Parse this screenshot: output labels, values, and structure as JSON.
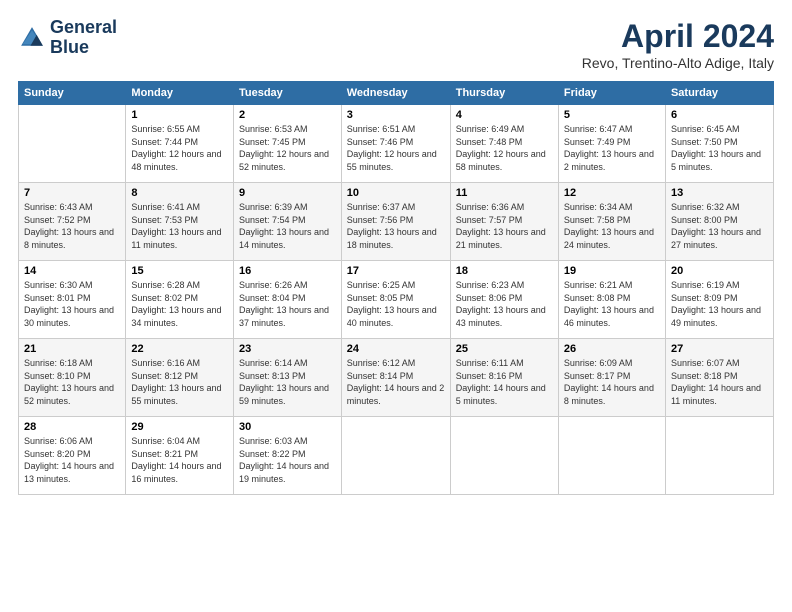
{
  "header": {
    "logo_line1": "General",
    "logo_line2": "Blue",
    "title": "April 2024",
    "subtitle": "Revo, Trentino-Alto Adige, Italy"
  },
  "weekdays": [
    "Sunday",
    "Monday",
    "Tuesday",
    "Wednesday",
    "Thursday",
    "Friday",
    "Saturday"
  ],
  "weeks": [
    [
      {
        "day": "",
        "sunrise": "",
        "sunset": "",
        "daylight": ""
      },
      {
        "day": "1",
        "sunrise": "Sunrise: 6:55 AM",
        "sunset": "Sunset: 7:44 PM",
        "daylight": "Daylight: 12 hours and 48 minutes."
      },
      {
        "day": "2",
        "sunrise": "Sunrise: 6:53 AM",
        "sunset": "Sunset: 7:45 PM",
        "daylight": "Daylight: 12 hours and 52 minutes."
      },
      {
        "day": "3",
        "sunrise": "Sunrise: 6:51 AM",
        "sunset": "Sunset: 7:46 PM",
        "daylight": "Daylight: 12 hours and 55 minutes."
      },
      {
        "day": "4",
        "sunrise": "Sunrise: 6:49 AM",
        "sunset": "Sunset: 7:48 PM",
        "daylight": "Daylight: 12 hours and 58 minutes."
      },
      {
        "day": "5",
        "sunrise": "Sunrise: 6:47 AM",
        "sunset": "Sunset: 7:49 PM",
        "daylight": "Daylight: 13 hours and 2 minutes."
      },
      {
        "day": "6",
        "sunrise": "Sunrise: 6:45 AM",
        "sunset": "Sunset: 7:50 PM",
        "daylight": "Daylight: 13 hours and 5 minutes."
      }
    ],
    [
      {
        "day": "7",
        "sunrise": "Sunrise: 6:43 AM",
        "sunset": "Sunset: 7:52 PM",
        "daylight": "Daylight: 13 hours and 8 minutes."
      },
      {
        "day": "8",
        "sunrise": "Sunrise: 6:41 AM",
        "sunset": "Sunset: 7:53 PM",
        "daylight": "Daylight: 13 hours and 11 minutes."
      },
      {
        "day": "9",
        "sunrise": "Sunrise: 6:39 AM",
        "sunset": "Sunset: 7:54 PM",
        "daylight": "Daylight: 13 hours and 14 minutes."
      },
      {
        "day": "10",
        "sunrise": "Sunrise: 6:37 AM",
        "sunset": "Sunset: 7:56 PM",
        "daylight": "Daylight: 13 hours and 18 minutes."
      },
      {
        "day": "11",
        "sunrise": "Sunrise: 6:36 AM",
        "sunset": "Sunset: 7:57 PM",
        "daylight": "Daylight: 13 hours and 21 minutes."
      },
      {
        "day": "12",
        "sunrise": "Sunrise: 6:34 AM",
        "sunset": "Sunset: 7:58 PM",
        "daylight": "Daylight: 13 hours and 24 minutes."
      },
      {
        "day": "13",
        "sunrise": "Sunrise: 6:32 AM",
        "sunset": "Sunset: 8:00 PM",
        "daylight": "Daylight: 13 hours and 27 minutes."
      }
    ],
    [
      {
        "day": "14",
        "sunrise": "Sunrise: 6:30 AM",
        "sunset": "Sunset: 8:01 PM",
        "daylight": "Daylight: 13 hours and 30 minutes."
      },
      {
        "day": "15",
        "sunrise": "Sunrise: 6:28 AM",
        "sunset": "Sunset: 8:02 PM",
        "daylight": "Daylight: 13 hours and 34 minutes."
      },
      {
        "day": "16",
        "sunrise": "Sunrise: 6:26 AM",
        "sunset": "Sunset: 8:04 PM",
        "daylight": "Daylight: 13 hours and 37 minutes."
      },
      {
        "day": "17",
        "sunrise": "Sunrise: 6:25 AM",
        "sunset": "Sunset: 8:05 PM",
        "daylight": "Daylight: 13 hours and 40 minutes."
      },
      {
        "day": "18",
        "sunrise": "Sunrise: 6:23 AM",
        "sunset": "Sunset: 8:06 PM",
        "daylight": "Daylight: 13 hours and 43 minutes."
      },
      {
        "day": "19",
        "sunrise": "Sunrise: 6:21 AM",
        "sunset": "Sunset: 8:08 PM",
        "daylight": "Daylight: 13 hours and 46 minutes."
      },
      {
        "day": "20",
        "sunrise": "Sunrise: 6:19 AM",
        "sunset": "Sunset: 8:09 PM",
        "daylight": "Daylight: 13 hours and 49 minutes."
      }
    ],
    [
      {
        "day": "21",
        "sunrise": "Sunrise: 6:18 AM",
        "sunset": "Sunset: 8:10 PM",
        "daylight": "Daylight: 13 hours and 52 minutes."
      },
      {
        "day": "22",
        "sunrise": "Sunrise: 6:16 AM",
        "sunset": "Sunset: 8:12 PM",
        "daylight": "Daylight: 13 hours and 55 minutes."
      },
      {
        "day": "23",
        "sunrise": "Sunrise: 6:14 AM",
        "sunset": "Sunset: 8:13 PM",
        "daylight": "Daylight: 13 hours and 59 minutes."
      },
      {
        "day": "24",
        "sunrise": "Sunrise: 6:12 AM",
        "sunset": "Sunset: 8:14 PM",
        "daylight": "Daylight: 14 hours and 2 minutes."
      },
      {
        "day": "25",
        "sunrise": "Sunrise: 6:11 AM",
        "sunset": "Sunset: 8:16 PM",
        "daylight": "Daylight: 14 hours and 5 minutes."
      },
      {
        "day": "26",
        "sunrise": "Sunrise: 6:09 AM",
        "sunset": "Sunset: 8:17 PM",
        "daylight": "Daylight: 14 hours and 8 minutes."
      },
      {
        "day": "27",
        "sunrise": "Sunrise: 6:07 AM",
        "sunset": "Sunset: 8:18 PM",
        "daylight": "Daylight: 14 hours and 11 minutes."
      }
    ],
    [
      {
        "day": "28",
        "sunrise": "Sunrise: 6:06 AM",
        "sunset": "Sunset: 8:20 PM",
        "daylight": "Daylight: 14 hours and 13 minutes."
      },
      {
        "day": "29",
        "sunrise": "Sunrise: 6:04 AM",
        "sunset": "Sunset: 8:21 PM",
        "daylight": "Daylight: 14 hours and 16 minutes."
      },
      {
        "day": "30",
        "sunrise": "Sunrise: 6:03 AM",
        "sunset": "Sunset: 8:22 PM",
        "daylight": "Daylight: 14 hours and 19 minutes."
      },
      {
        "day": "",
        "sunrise": "",
        "sunset": "",
        "daylight": ""
      },
      {
        "day": "",
        "sunrise": "",
        "sunset": "",
        "daylight": ""
      },
      {
        "day": "",
        "sunrise": "",
        "sunset": "",
        "daylight": ""
      },
      {
        "day": "",
        "sunrise": "",
        "sunset": "",
        "daylight": ""
      }
    ]
  ]
}
